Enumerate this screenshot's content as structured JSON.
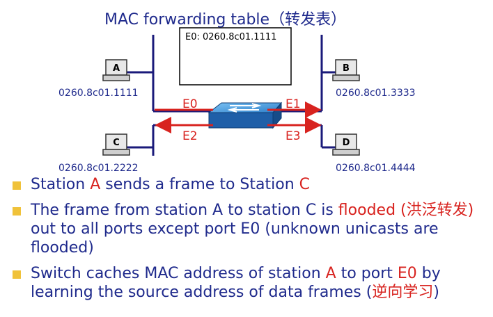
{
  "title": "MAC forwarding  table（转发表）",
  "table_entry": "E0:  0260.8c01.1111",
  "stations": {
    "A": {
      "label": "A",
      "mac": "0260.8c01.1111"
    },
    "B": {
      "label": "B",
      "mac": "0260.8c01.3333"
    },
    "C": {
      "label": "C",
      "mac": "0260.8c01.2222"
    },
    "D": {
      "label": "D",
      "mac": "0260.8c01.4444"
    }
  },
  "ports": {
    "e0": "E0",
    "e1": "E1",
    "e2": "E2",
    "e3": "E3"
  },
  "bullets": [
    {
      "parts": [
        "Station ",
        "A",
        " sends a frame to Station ",
        "C"
      ]
    },
    {
      "parts": [
        "The frame from station A to station C is ",
        "flooded (洪泛转发)",
        " out to all ports except port E0 (unknown unicasts are flooded)"
      ]
    },
    {
      "parts": [
        "Switch caches MAC address of station ",
        "A",
        " to port ",
        "E0",
        " by learning the source address of data frames (",
        "逆向学习",
        ")"
      ]
    }
  ],
  "colors": {
    "text_blue": "#1f2a8c",
    "accent_red": "#d8231f",
    "bullet": "#f0c23a",
    "wire": "#1a1a7a",
    "switch": "#3a8fd6"
  }
}
